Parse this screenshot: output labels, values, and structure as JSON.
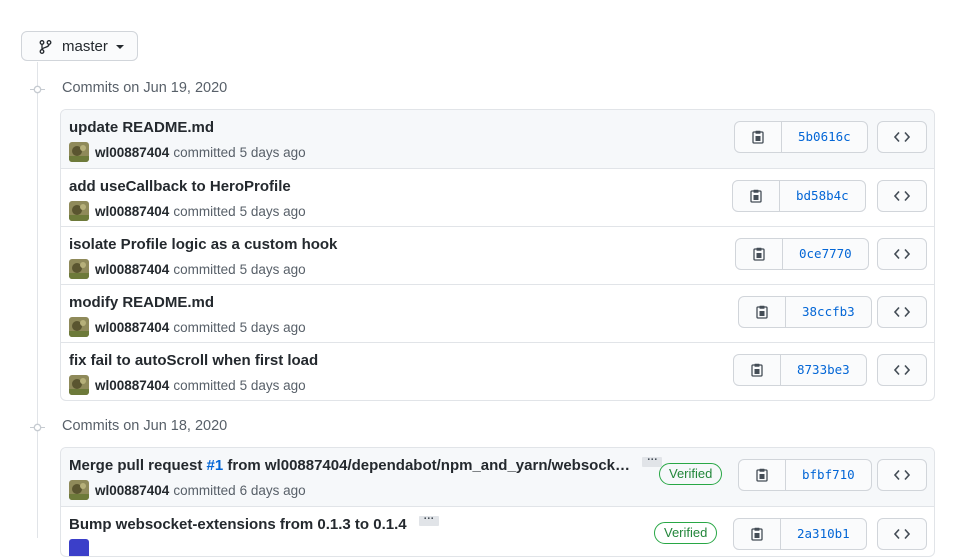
{
  "branch": {
    "label": "master",
    "icon": "git-branch-icon"
  },
  "groups": [
    {
      "title": "Commits on Jun 19, 2020",
      "commits": [
        {
          "message": "update README.md",
          "author": "wl00887404",
          "action": "committed",
          "time": "5 days ago",
          "sha": "5b0616c"
        },
        {
          "message": "add useCallback to HeroProfile",
          "author": "wl00887404",
          "action": "committed",
          "time": "5 days ago",
          "sha": "bd58b4c"
        },
        {
          "message": "isolate Profile logic as a custom hook",
          "author": "wl00887404",
          "action": "committed",
          "time": "5 days ago",
          "sha": "0ce7770"
        },
        {
          "message": "modify README.md",
          "author": "wl00887404",
          "action": "committed",
          "time": "5 days ago",
          "sha": "38ccfb3"
        },
        {
          "message": "fix fail to autoScroll when first load",
          "author": "wl00887404",
          "action": "committed",
          "time": "5 days ago",
          "sha": "8733be3"
        }
      ]
    },
    {
      "title": "Commits on Jun 18, 2020",
      "commits": [
        {
          "message_prefix": "Merge pull request ",
          "pr_link": "#1",
          "message_suffix": " from wl00887404/dependabot/npm_and_yarn/websock…",
          "ellipsis": "…",
          "verified": "Verified",
          "author": "wl00887404",
          "action": "committed",
          "time": "6 days ago",
          "sha": "bfbf710"
        },
        {
          "message": "Bump websocket-extensions from 0.1.3 to 0.1.4",
          "ellipsis": "…",
          "verified": "Verified",
          "sha": "2a310b1"
        }
      ]
    }
  ],
  "colors": {
    "link": "#0366d6",
    "verified": "#22863a",
    "border": "#e1e4e8"
  }
}
